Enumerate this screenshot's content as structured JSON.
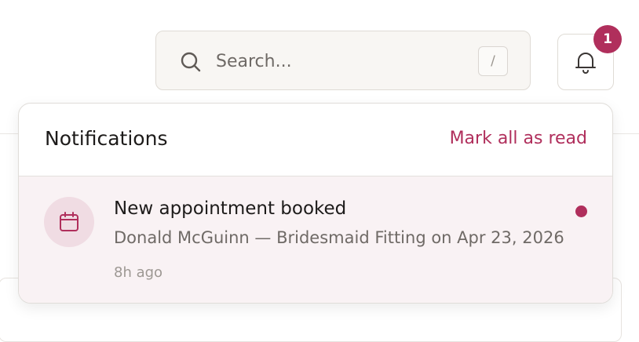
{
  "search": {
    "placeholder": "Search...",
    "shortcut": "/"
  },
  "notifications_button": {
    "badge_count": "1"
  },
  "notifications_panel": {
    "title": "Notifications",
    "mark_all_label": "Mark all as read",
    "items": [
      {
        "title": "New appointment booked",
        "body": "Donald McGuinn — Bridesmaid Fitting on Apr 23, 2026",
        "time": "8h ago",
        "icon": "calendar-icon",
        "unread": true
      }
    ]
  },
  "colors": {
    "accent": "#b02f5c",
    "unread_bg": "#f9f2f4",
    "icon_circle": "#f0dce3"
  }
}
